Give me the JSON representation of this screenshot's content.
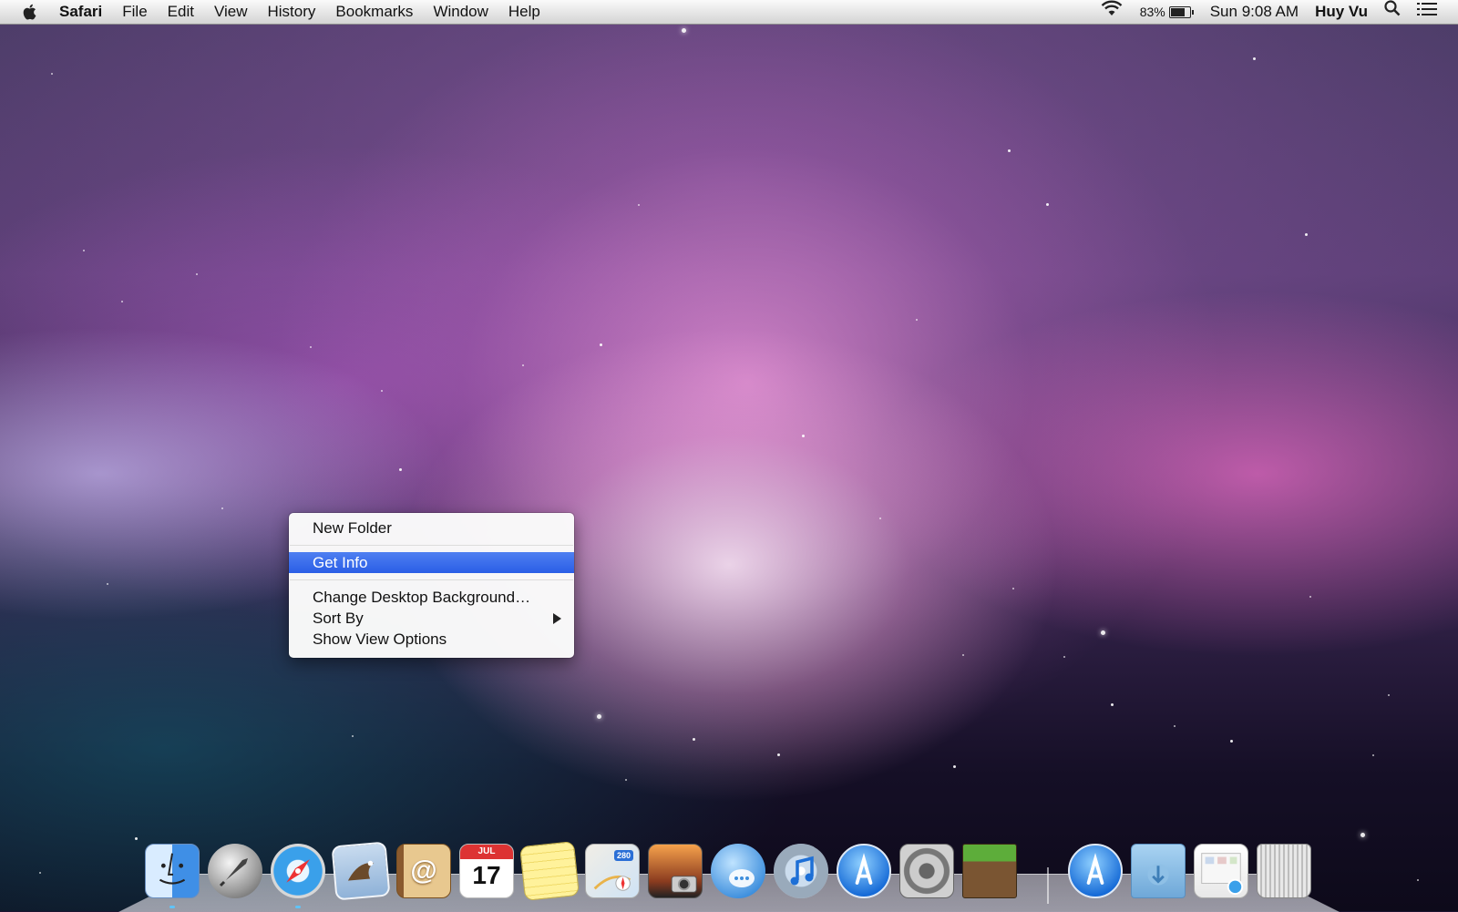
{
  "menubar": {
    "apple_icon": "apple-icon",
    "app_name": "Safari",
    "menus": [
      "File",
      "Edit",
      "View",
      "History",
      "Bookmarks",
      "Window",
      "Help"
    ],
    "wifi_icon": "wifi-icon",
    "battery_percent": "83%",
    "battery_level": 0.83,
    "clock": "Sun 9:08 AM",
    "user": "Huy Vu",
    "spotlight_icon": "search-icon",
    "notification_icon": "list-icon"
  },
  "context_menu": {
    "items": [
      {
        "label": "New Folder"
      },
      {
        "label": "Get Info",
        "highlighted": true
      },
      {
        "label": "Change Desktop Background…"
      },
      {
        "label": "Sort By",
        "submenu": true
      },
      {
        "label": "Show View Options"
      }
    ]
  },
  "dock": {
    "apps": [
      {
        "name": "finder-icon"
      },
      {
        "name": "launchpad-icon"
      },
      {
        "name": "safari-icon"
      },
      {
        "name": "mail-icon"
      },
      {
        "name": "contacts-icon",
        "glyph": "@"
      },
      {
        "name": "calendar-icon",
        "month": "JUL",
        "day": "17"
      },
      {
        "name": "notes-icon"
      },
      {
        "name": "maps-icon",
        "glyph": "280"
      },
      {
        "name": "photo-booth-icon"
      },
      {
        "name": "messages-icon"
      },
      {
        "name": "itunes-icon"
      },
      {
        "name": "app-store-icon"
      },
      {
        "name": "system-preferences-icon"
      },
      {
        "name": "minecraft-icon"
      }
    ],
    "stacks": [
      {
        "name": "applications-stack-icon"
      },
      {
        "name": "downloads-stack-icon"
      },
      {
        "name": "documents-stack-icon"
      },
      {
        "name": "trash-icon"
      }
    ]
  }
}
